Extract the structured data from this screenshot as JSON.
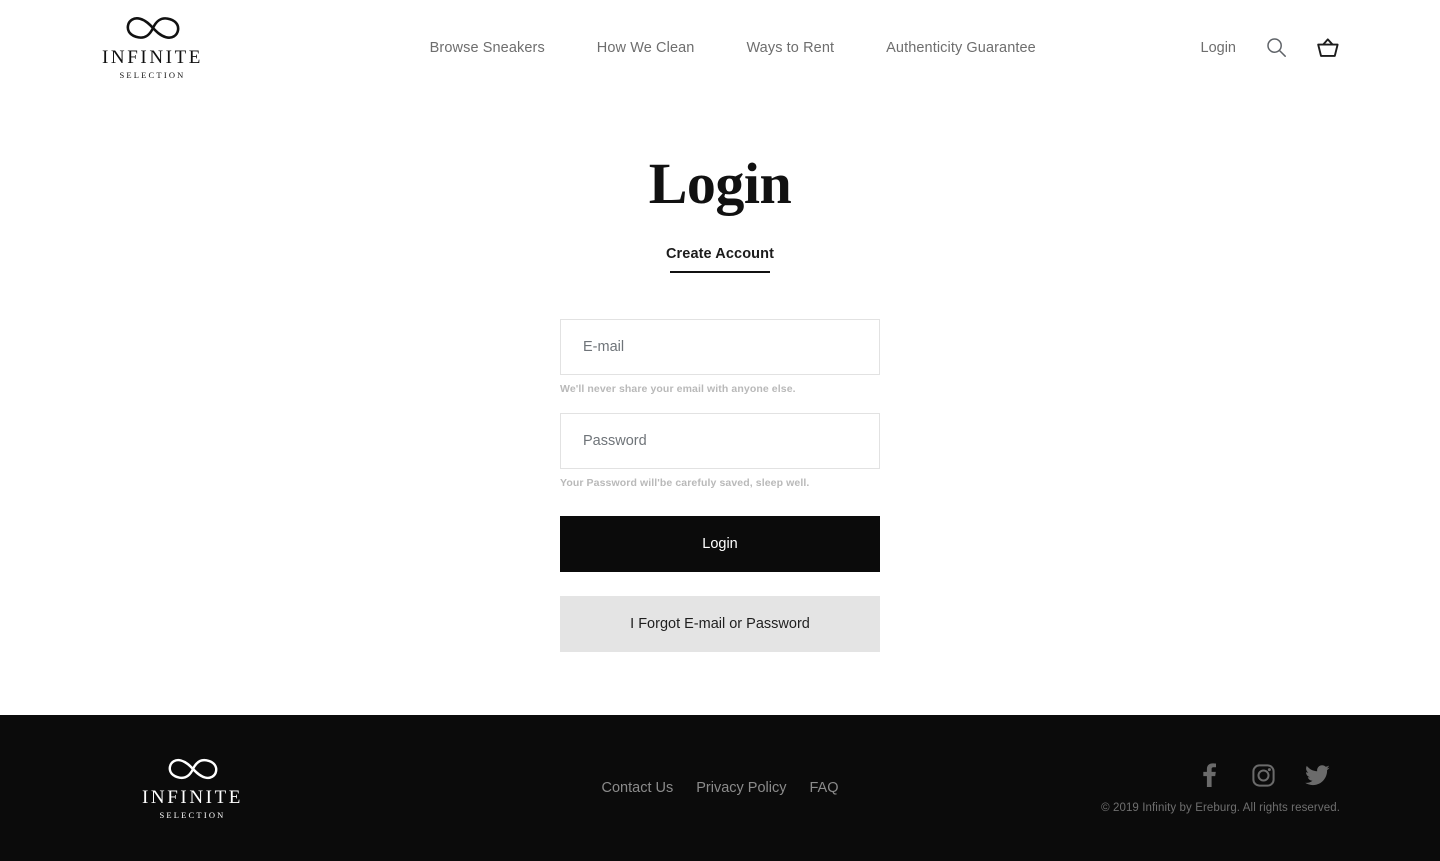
{
  "header": {
    "brand": {
      "icon": "infinity-logo-icon",
      "name": "INFINITE",
      "sub": "SELECTION"
    },
    "nav": [
      {
        "label": "Browse Sneakers"
      },
      {
        "label": "How We Clean"
      },
      {
        "label": "Ways to Rent"
      },
      {
        "label": "Authenticity Guarantee"
      }
    ],
    "login_label": "Login",
    "search_icon": "search-icon",
    "cart_icon": "basket-icon"
  },
  "main": {
    "title": "Login",
    "create_account_label": "Create Account",
    "fields": {
      "email": {
        "placeholder": "E-mail",
        "value": "",
        "helper": "We'll never share your email with anyone else."
      },
      "password": {
        "placeholder": "Password",
        "value": "",
        "helper": "Your Password will'be carefuly saved, sleep well."
      }
    },
    "submit_label": "Login",
    "forgot_label": "I Forgot E-mail or Password"
  },
  "footer": {
    "brand": {
      "icon": "infinity-logo-icon",
      "name": "INFINITE",
      "sub": "SELECTION"
    },
    "nav": [
      {
        "label": "Contact Us"
      },
      {
        "label": "Privacy Policy"
      },
      {
        "label": "FAQ"
      }
    ],
    "socials": [
      {
        "icon": "facebook-icon"
      },
      {
        "icon": "instagram-icon"
      },
      {
        "icon": "twitter-icon"
      }
    ],
    "copyright": "© 2019 Infinity by Ereburg. All rights reserved."
  },
  "colors": {
    "accent_dark": "#0b0b0b",
    "secondary_button": "#e4e4e4",
    "muted_text": "#6e6e6e",
    "helper_text": "#b9b9b9",
    "input_border": "#e2e2e2"
  }
}
